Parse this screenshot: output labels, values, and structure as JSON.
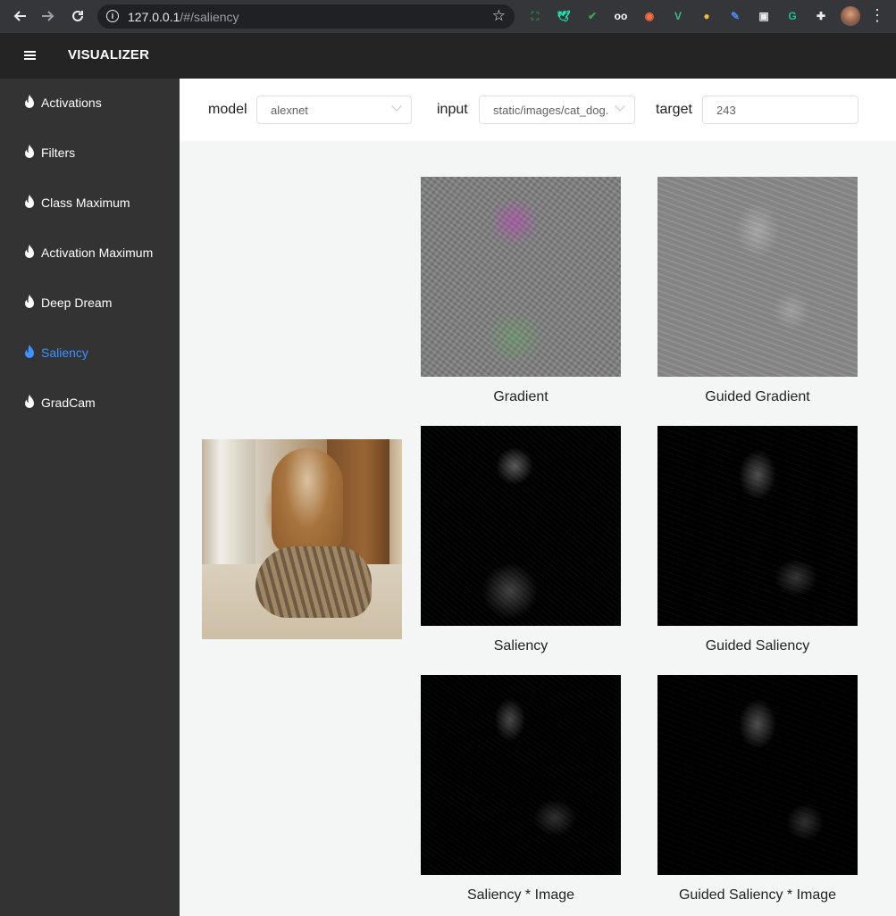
{
  "browser": {
    "url_host": "127.0.0.1",
    "url_path": "/#/saliency",
    "extensions": [
      {
        "icon": "screenshot-ext-icon",
        "glyph": "⛶",
        "color": "#1e8e3e"
      },
      {
        "icon": "bird-ext-icon",
        "glyph": "🕊",
        "color": "#1de9b6"
      },
      {
        "icon": "shield-ext-icon",
        "glyph": "✔",
        "color": "#34a853"
      },
      {
        "icon": "glasses-ext-icon",
        "glyph": "oo",
        "color": "#ffffff"
      },
      {
        "icon": "owl-ext-icon",
        "glyph": "◉",
        "color": "#ff7043"
      },
      {
        "icon": "vue-ext-icon",
        "glyph": "V",
        "color": "#42b883"
      },
      {
        "icon": "ball-ext-icon",
        "glyph": "●",
        "color": "#f5b942"
      },
      {
        "icon": "feather-ext-icon",
        "glyph": "✎",
        "color": "#4a8bf5"
      },
      {
        "icon": "window-ext-icon",
        "glyph": "▣",
        "color": "#e8eaed"
      },
      {
        "icon": "grammarly-ext-icon",
        "glyph": "G",
        "color": "#15c39a"
      },
      {
        "icon": "puzzle-ext-icon",
        "glyph": "✚",
        "color": "#e8eaed"
      }
    ]
  },
  "app": {
    "title": "VISUALIZER"
  },
  "sidebar": {
    "items": [
      {
        "label": "Activations",
        "active": false
      },
      {
        "label": "Filters",
        "active": false
      },
      {
        "label": "Class Maximum",
        "active": false
      },
      {
        "label": "Activation Maximum",
        "active": false
      },
      {
        "label": "Deep Dream",
        "active": false
      },
      {
        "label": "Saliency",
        "active": true
      },
      {
        "label": "GradCam",
        "active": false
      }
    ]
  },
  "toolbar": {
    "model_label": "model",
    "model_value": "alexnet",
    "input_label": "input",
    "input_value": "static/images/cat_dog.png",
    "target_label": "target",
    "target_value": "243"
  },
  "results": {
    "gradient": "Gradient",
    "guided_gradient": "Guided Gradient",
    "saliency": "Saliency",
    "guided_saliency": "Guided Saliency",
    "saliency_image": "Saliency * Image",
    "guided_saliency_image": "Guided Saliency * Image"
  },
  "colors": {
    "active": "#3f92ff",
    "sidebar": "#333333",
    "header": "#242424"
  }
}
